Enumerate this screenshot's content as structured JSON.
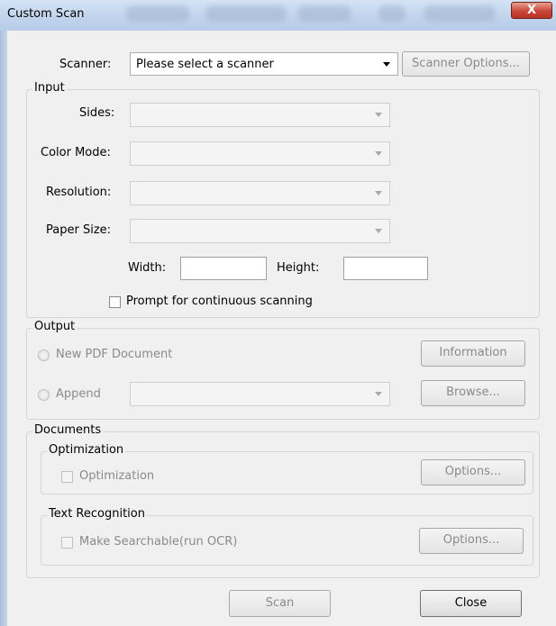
{
  "window": {
    "title": "Custom Scan",
    "close_glyph": "X"
  },
  "scanner": {
    "label": "Scanner:",
    "value": "Please select a scanner",
    "options_button": "Scanner Options..."
  },
  "input": {
    "legend": "Input",
    "sides_label": "Sides:",
    "color_mode_label": "Color Mode:",
    "resolution_label": "Resolution:",
    "paper_size_label": "Paper Size:",
    "width_label": "Width:",
    "height_label": "Height:",
    "prompt_label": "Prompt for continuous scanning"
  },
  "output": {
    "legend": "Output",
    "new_pdf_label": "New PDF Document",
    "append_label": "Append",
    "information_button": "Information",
    "browse_button": "Browse..."
  },
  "documents": {
    "legend": "Documents",
    "optimization": {
      "legend": "Optimization",
      "checkbox_label": "Optimization",
      "options_button": "Options..."
    },
    "text_recognition": {
      "legend": "Text Recognition",
      "checkbox_label": "Make Searchable(run OCR)",
      "options_button": "Options..."
    }
  },
  "footer": {
    "scan_button": "Scan",
    "close_button": "Close"
  }
}
